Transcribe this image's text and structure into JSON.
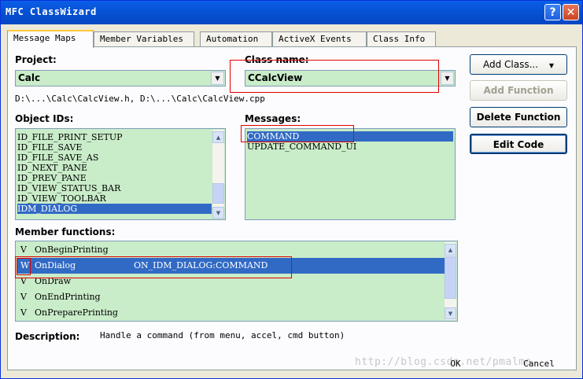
{
  "window": {
    "title": "MFC ClassWizard",
    "help_label": "?",
    "close_label": "✕"
  },
  "tabs": [
    {
      "label": "Message Maps",
      "active": true
    },
    {
      "label": "Member Variables",
      "active": false
    },
    {
      "label": "Automation",
      "active": false
    },
    {
      "label": "ActiveX Events",
      "active": false
    },
    {
      "label": "Class Info",
      "active": false
    }
  ],
  "project": {
    "label": "Project:",
    "value": "Calc"
  },
  "class_name": {
    "label": "Class name:",
    "value": "CCalcView"
  },
  "file_paths": "D:\\...\\Calc\\CalcView.h, D:\\...\\Calc\\CalcView.cpp",
  "object_ids": {
    "label": "Object IDs:",
    "items": [
      "ID_FILE_PRINT_SETUP",
      "ID_FILE_SAVE",
      "ID_FILE_SAVE_AS",
      "ID_NEXT_PANE",
      "ID_PREV_PANE",
      "ID_VIEW_STATUS_BAR",
      "ID_VIEW_TOOLBAR",
      "IDM_DIALOG"
    ],
    "selected": "IDM_DIALOG"
  },
  "messages": {
    "label": "Messages:",
    "items": [
      "COMMAND",
      "UPDATE_COMMAND_UI"
    ],
    "selected": "COMMAND"
  },
  "member_functions": {
    "label": "Member functions:",
    "rows": [
      {
        "marker": "V",
        "name": "OnBeginPrinting",
        "handler": ""
      },
      {
        "marker": "W",
        "name": "OnDialog",
        "handler": "ON_IDM_DIALOG:COMMAND"
      },
      {
        "marker": "V",
        "name": "OnDraw",
        "handler": ""
      },
      {
        "marker": "V",
        "name": "OnEndPrinting",
        "handler": ""
      },
      {
        "marker": "V",
        "name": "OnPreparePrinting",
        "handler": ""
      }
    ],
    "selected": "OnDialog"
  },
  "description": {
    "label": "Description:",
    "value": "Handle a command (from menu, accel, cmd button)"
  },
  "buttons": {
    "add_class": "Add Class...",
    "add_function": "Add Function",
    "delete_function": "Delete Function",
    "edit_code": "Edit Code",
    "ok": "OK",
    "cancel": "Cancel"
  },
  "watermark": "http://blog.csdn.net/pmalma",
  "colors": {
    "list_background": "#c9ecc9",
    "selection": "#316ac5",
    "highlight_box": "#e00000"
  }
}
